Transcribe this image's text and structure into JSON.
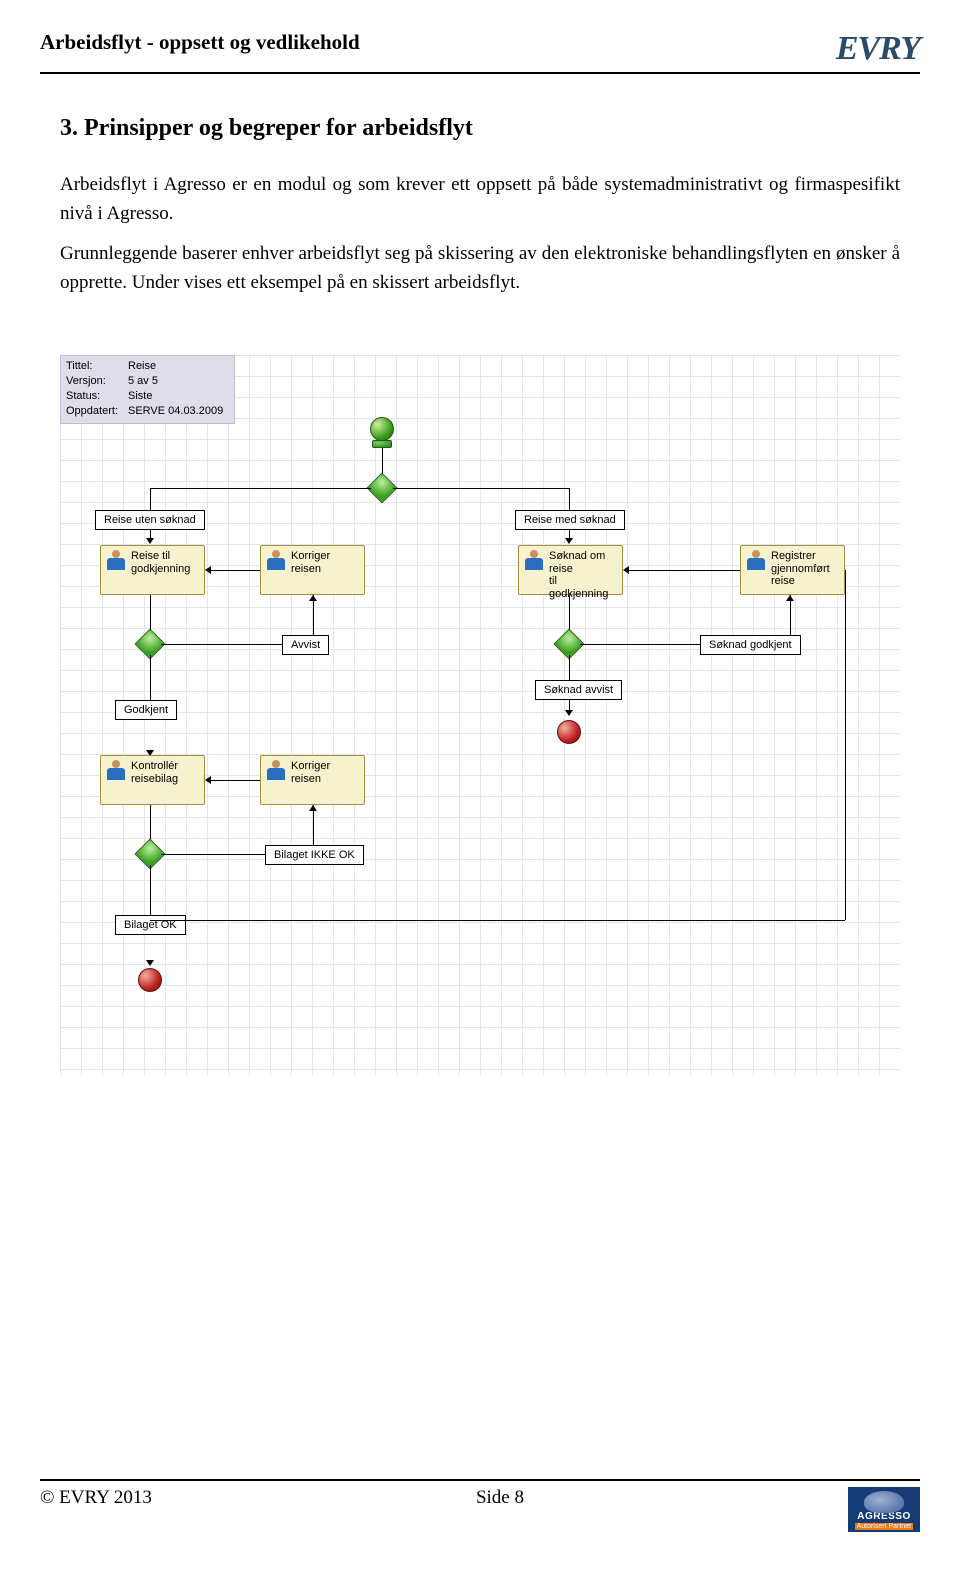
{
  "header": {
    "title": "Arbeidsflyt - oppsett og vedlikehold",
    "logo_text": "EVRY"
  },
  "section": {
    "heading": "3. Prinsipper og begreper for arbeidsflyt",
    "para1": "Arbeidsflyt i Agresso er en modul og som krever ett oppsett på både systemadministrativt og firmaspesifikt nivå i Agresso.",
    "para2": "Grunnleggende baserer enhver arbeidsflyt seg på skissering av den elektroniske behandlingsflyten en ønsker å opprette. Under vises ett eksempel på en skissert arbeidsflyt."
  },
  "diagram": {
    "meta": {
      "rows": [
        {
          "k": "Tittel:",
          "v": "Reise"
        },
        {
          "k": "Versjon:",
          "v": "5 av 5"
        },
        {
          "k": "Status:",
          "v": "Siste"
        },
        {
          "k": "Oppdatert:",
          "v": "SERVE 04.03.2009"
        }
      ]
    },
    "labels": {
      "reise_uten": "Reise uten søknad",
      "reise_med": "Reise med søknad",
      "avvist": "Avvist",
      "soknad_godkj": "Søknad godkjent",
      "soknad_avvist": "Søknad avvist",
      "godkjent": "Godkjent",
      "bilaget_ikke": "Bilaget IKKE OK",
      "bilaget_ok": "Bilaget OK"
    },
    "tasks": {
      "reise_godkj": "Reise til godkjenning",
      "korriger1": "Korriger reisen",
      "soknad_om": "Søknad om reise\ntil godkjenning",
      "registrer": "Registrer\ngjennomført reise",
      "kontroller": "Kontrollér\nreisebilag",
      "korriger2": "Korriger reisen"
    }
  },
  "footer": {
    "copyright": "© EVRY 2013",
    "page": "Side 8",
    "badge_brand": "AGRESSO",
    "badge_sub": "Autorisert Partner"
  }
}
